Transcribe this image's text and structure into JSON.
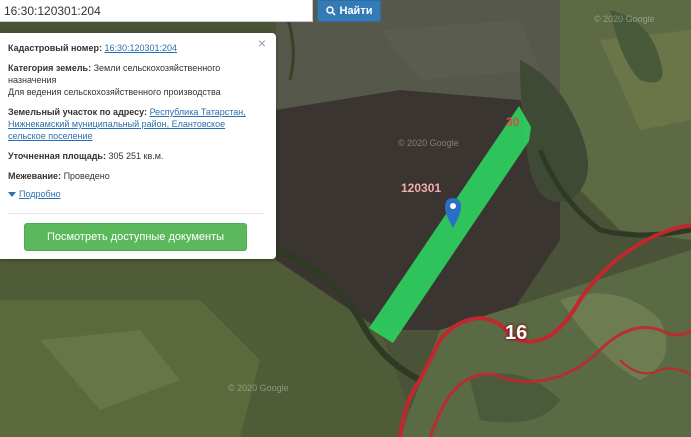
{
  "search": {
    "value": "16:30:120301:204",
    "button_label": "Найти"
  },
  "info": {
    "cadastral_label": "Кадастровый номер:",
    "cadastral_value": "16:30:120301:204",
    "category_label": "Категория земель:",
    "category_value": "Земли сельскохозяйственного назначения",
    "usage_value": "Для ведения сельскохозяйственного производства",
    "address_label": "Земельный участок по адресу:",
    "address_value": "Республика Татарстан, Нижнекамский муниципальный район, Елантовское сельское поселение",
    "area_label": "Уточненная площадь:",
    "area_value": "305 251 кв.м.",
    "survey_label": "Межевание:",
    "survey_value": "Проведено",
    "more_label": "Подробно",
    "docs_button": "Посмотреть доступные документы"
  },
  "map": {
    "label_block": "120301",
    "label_30": "30",
    "label_16": "16",
    "watermark_1": "© 2020 Google",
    "watermark_2": "© 2020 Google",
    "watermark_3": "© 2020 Google"
  },
  "colors": {
    "parcel": "#2ecc5e",
    "boundary": "#c0282d",
    "accent": "#337ab7",
    "button_green": "#5cb85c"
  }
}
